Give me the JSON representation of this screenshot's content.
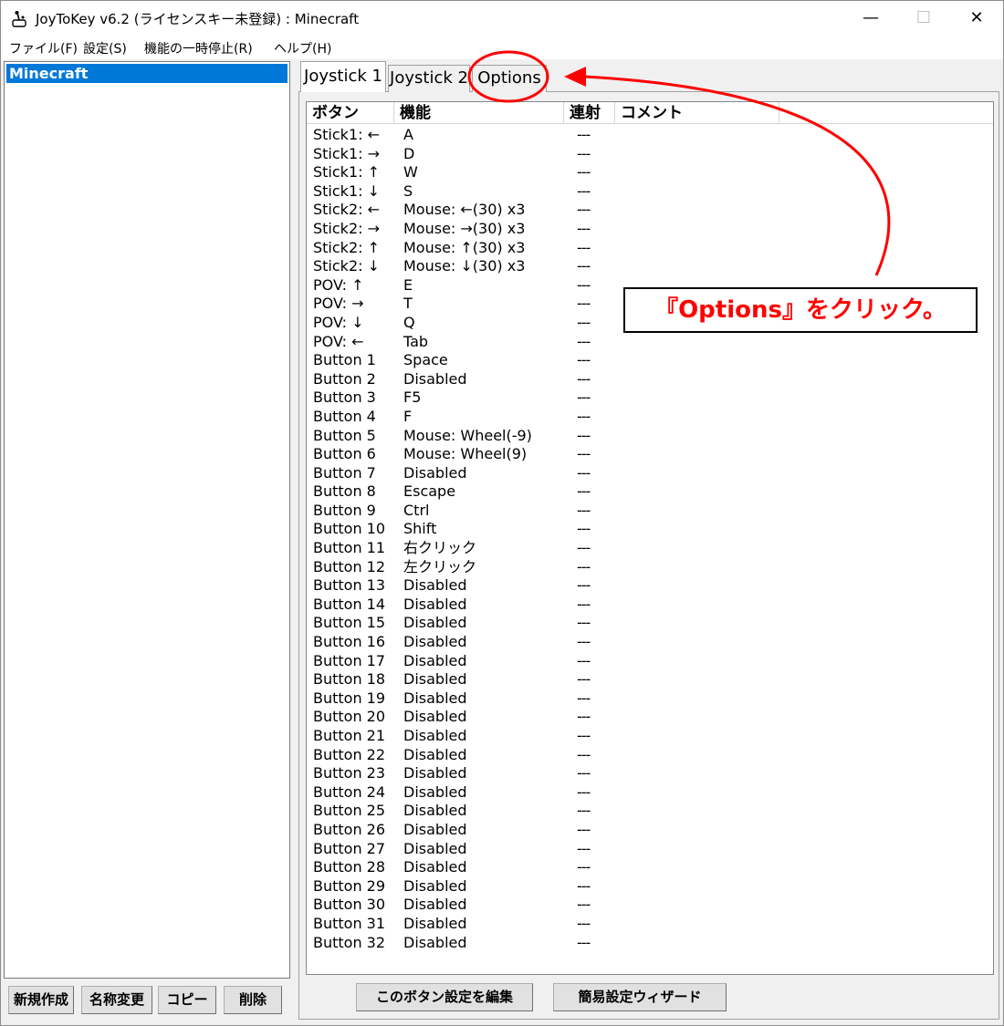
{
  "window": {
    "title": "JoyToKey v6.2 (ライセンスキー未登録) : Minecraft",
    "minimize_icon": "—",
    "maximize_icon": "☐",
    "close_icon": "✕"
  },
  "menu": [
    "ファイル(F)",
    "設定(S)",
    "機能の一時停止(R)",
    "ヘルプ(H)"
  ],
  "profiles": {
    "selected": "Minecraft"
  },
  "left_buttons": [
    "新規作成",
    "名称変更",
    "コピー",
    "削除"
  ],
  "tabs": [
    "Joystick 1",
    "Joystick 2",
    "Options"
  ],
  "columns": [
    "ボタン",
    "機能",
    "連射",
    "コメント"
  ],
  "rows": [
    {
      "button": "Stick1: ←",
      "function": "A",
      "repeat": "---"
    },
    {
      "button": "Stick1: →",
      "function": "D",
      "repeat": "---"
    },
    {
      "button": "Stick1: ↑",
      "function": "W",
      "repeat": "---"
    },
    {
      "button": "Stick1: ↓",
      "function": "S",
      "repeat": "---"
    },
    {
      "button": "Stick2: ←",
      "function": "Mouse: ←(30) x3",
      "repeat": "---"
    },
    {
      "button": "Stick2: →",
      "function": "Mouse: →(30) x3",
      "repeat": "---"
    },
    {
      "button": "Stick2: ↑",
      "function": "Mouse: ↑(30) x3",
      "repeat": "---"
    },
    {
      "button": "Stick2: ↓",
      "function": "Mouse: ↓(30) x3",
      "repeat": "---"
    },
    {
      "button": "POV: ↑",
      "function": "E",
      "repeat": "---"
    },
    {
      "button": "POV: →",
      "function": "T",
      "repeat": "---"
    },
    {
      "button": "POV: ↓",
      "function": "Q",
      "repeat": "---"
    },
    {
      "button": "POV: ←",
      "function": "Tab",
      "repeat": "---"
    },
    {
      "button": "Button 1",
      "function": "Space",
      "repeat": "---"
    },
    {
      "button": "Button 2",
      "function": "Disabled",
      "repeat": "---"
    },
    {
      "button": "Button 3",
      "function": "F5",
      "repeat": "---"
    },
    {
      "button": "Button 4",
      "function": "F",
      "repeat": "---"
    },
    {
      "button": "Button 5",
      "function": "Mouse: Wheel(-9)",
      "repeat": "---"
    },
    {
      "button": "Button 6",
      "function": "Mouse: Wheel(9)",
      "repeat": "---"
    },
    {
      "button": "Button 7",
      "function": "Disabled",
      "repeat": "---"
    },
    {
      "button": "Button 8",
      "function": "Escape",
      "repeat": "---"
    },
    {
      "button": "Button 9",
      "function": "Ctrl",
      "repeat": "---"
    },
    {
      "button": "Button 10",
      "function": "Shift",
      "repeat": "---"
    },
    {
      "button": "Button 11",
      "function": "右クリック",
      "repeat": "---"
    },
    {
      "button": "Button 12",
      "function": "左クリック",
      "repeat": "---"
    },
    {
      "button": "Button 13",
      "function": "Disabled",
      "repeat": "---"
    },
    {
      "button": "Button 14",
      "function": "Disabled",
      "repeat": "---"
    },
    {
      "button": "Button 15",
      "function": "Disabled",
      "repeat": "---"
    },
    {
      "button": "Button 16",
      "function": "Disabled",
      "repeat": "---"
    },
    {
      "button": "Button 17",
      "function": "Disabled",
      "repeat": "---"
    },
    {
      "button": "Button 18",
      "function": "Disabled",
      "repeat": "---"
    },
    {
      "button": "Button 19",
      "function": "Disabled",
      "repeat": "---"
    },
    {
      "button": "Button 20",
      "function": "Disabled",
      "repeat": "---"
    },
    {
      "button": "Button 21",
      "function": "Disabled",
      "repeat": "---"
    },
    {
      "button": "Button 22",
      "function": "Disabled",
      "repeat": "---"
    },
    {
      "button": "Button 23",
      "function": "Disabled",
      "repeat": "---"
    },
    {
      "button": "Button 24",
      "function": "Disabled",
      "repeat": "---"
    },
    {
      "button": "Button 25",
      "function": "Disabled",
      "repeat": "---"
    },
    {
      "button": "Button 26",
      "function": "Disabled",
      "repeat": "---"
    },
    {
      "button": "Button 27",
      "function": "Disabled",
      "repeat": "---"
    },
    {
      "button": "Button 28",
      "function": "Disabled",
      "repeat": "---"
    },
    {
      "button": "Button 29",
      "function": "Disabled",
      "repeat": "---"
    },
    {
      "button": "Button 30",
      "function": "Disabled",
      "repeat": "---"
    },
    {
      "button": "Button 31",
      "function": "Disabled",
      "repeat": "---"
    },
    {
      "button": "Button 32",
      "function": "Disabled",
      "repeat": "---"
    }
  ],
  "bottom_buttons": [
    "このボタン設定を編集",
    "簡易設定ウィザード"
  ],
  "annotation": {
    "text": "『Options』をクリック。",
    "color": "#ff0000"
  }
}
